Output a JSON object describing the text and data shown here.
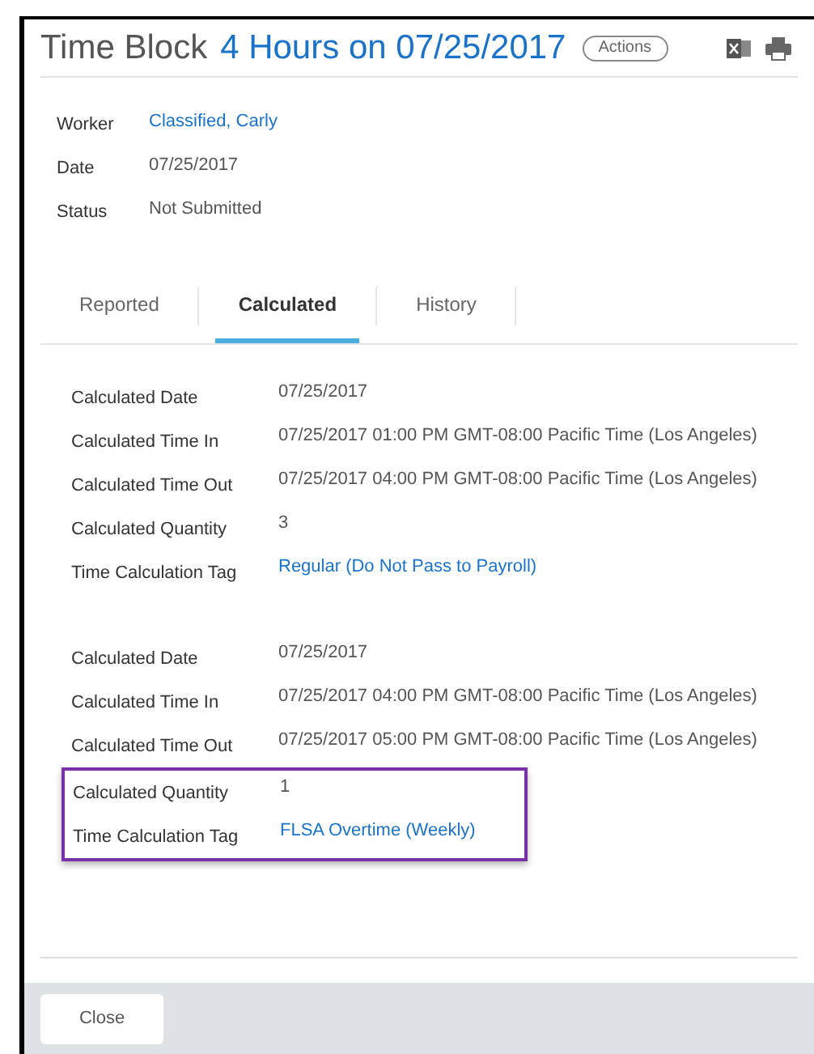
{
  "header": {
    "title": "Time Block",
    "subtitle": "4 Hours on 07/25/2017",
    "actions_button": "Actions"
  },
  "fields": [
    {
      "label": "Worker",
      "value": "Classified, Carly",
      "link": true
    },
    {
      "label": "Date",
      "value": "07/25/2017",
      "link": false
    },
    {
      "label": "Status",
      "value": "Not Submitted",
      "link": false
    }
  ],
  "tabs": [
    {
      "label": "Reported",
      "selected": false
    },
    {
      "label": "Calculated",
      "selected": true
    },
    {
      "label": "History",
      "selected": false
    }
  ],
  "groups": [
    {
      "rows": [
        {
          "label": "Calculated Date",
          "value": "07/25/2017",
          "link": false,
          "highlighted": false
        },
        {
          "label": "Calculated Time In",
          "value": "07/25/2017 01:00 PM GMT-08:00 Pacific Time (Los Angeles)",
          "link": false,
          "highlighted": false
        },
        {
          "label": "Calculated Time Out",
          "value": "07/25/2017 04:00 PM GMT-08:00 Pacific Time (Los Angeles)",
          "link": false,
          "highlighted": false
        },
        {
          "label": "Calculated Quantity",
          "value": "3",
          "link": false,
          "highlighted": false
        },
        {
          "label": "Time Calculation Tag",
          "value": "Regular (Do Not Pass to Payroll)",
          "link": true,
          "highlighted": false
        }
      ]
    },
    {
      "rows": [
        {
          "label": "Calculated Date",
          "value": "07/25/2017",
          "link": false,
          "highlighted": false
        },
        {
          "label": "Calculated Time In",
          "value": "07/25/2017 04:00 PM GMT-08:00 Pacific Time (Los Angeles)",
          "link": false,
          "highlighted": false
        },
        {
          "label": "Calculated Time Out",
          "value": "07/25/2017 05:00 PM GMT-08:00 Pacific Time (Los Angeles)",
          "link": false,
          "highlighted": false
        },
        {
          "label": "Calculated Quantity",
          "value": "1",
          "link": false,
          "highlighted": true
        },
        {
          "label": "Time Calculation Tag",
          "value": "FLSA Overtime (Weekly)",
          "link": true,
          "highlighted": true
        }
      ]
    }
  ],
  "footer": {
    "close_button": "Close"
  }
}
